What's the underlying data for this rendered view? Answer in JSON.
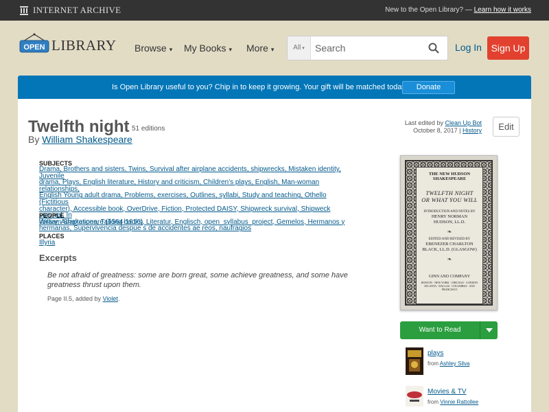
{
  "ia_bar": {
    "logo_text": "INTERNET ARCHIVE",
    "new_text": "New to the Open Library? —",
    "learn_link": "Learn how it works"
  },
  "header": {
    "logo_open": "OPEN",
    "logo_library": "LIBRARY",
    "nav": [
      {
        "label": "Browse"
      },
      {
        "label": "My Books"
      },
      {
        "label": "More"
      }
    ],
    "search": {
      "scope": "All",
      "placeholder": "Search"
    },
    "login": "Log In",
    "signup": "Sign Up"
  },
  "donate": {
    "text": "Is Open Library useful to you? Chip in to keep it growing. Your gift will be matched today!",
    "button": "Donate"
  },
  "work": {
    "title": "Twelfth night",
    "editions": "51 editions",
    "by": "By",
    "author": "William Shakespeare",
    "last_edited_prefix": "Last edited by",
    "last_edited_by": "Clean Up Bot",
    "last_edited_date": "October 8, 2017",
    "history": "History",
    "edit": "Edit"
  },
  "subjects": {
    "heading": "SUBJECTS",
    "lines": [
      "Drama, Brothers and sisters, Twins, Survival after airplane accidents, shipwrecks, Mistaken identity, Juvenile",
      "drama, Plays, English literature, History and criticism, Children's plays, English, Man-woman relationships,",
      "English Young adult drama, Problems, exercises, Outlines, syllabi, Study and teaching, Othello (Fictitious",
      "character), Accessible book, OverDrive, Fiction, Protected DAISY, Shipwreck survival, Shipweck survival, In",
      "library, Adaptations, Talking books, Literatur, Englisch, open_syllabus_project, Gemelos, Hermanos y",
      "hermanas, Supervivencia despue s de accidentes ae reos, naufragios"
    ]
  },
  "people": {
    "heading": "PEOPLE",
    "value": "William Shakespeare (1564-1616)"
  },
  "places": {
    "heading": "PLACES",
    "value": "Illyria"
  },
  "excerpts": {
    "heading": "Excerpts",
    "quote": "Be not afraid of greatness: some are born great, some achieve greatness, and some have greatness thrust upon them.",
    "page_prefix": "Page II.5, added by",
    "added_by": "Violet",
    "page_suffix": "."
  },
  "cover": {
    "series": "THE NEW HUDSON SHAKESPEARE",
    "title1": "TWELFTH NIGHT",
    "title2": "OR WHAT YOU WILL",
    "intro": "INTRODUCTION AND NOTES BY",
    "editor1": "HENRY NORMAN",
    "editor2": "HUDSON, LL.D.",
    "edited_by": "EDITED AND REVISED BY",
    "reviser1": "EBENEZER CHARLTON",
    "reviser2": "BLACK, LL.D. (GLASGOW)",
    "publisher": "GINN AND COMPANY",
    "cities": "BOSTON · NEW YORK · CHICAGO · LONDON ATLANTA · DALLAS · COLUMBUS · SAN FRANCISCO"
  },
  "want_to_read": "Want to Read",
  "lists": [
    {
      "name": "plays",
      "from": "from",
      "user": "Ashley Silva"
    },
    {
      "name": "Movies & TV",
      "from": "from",
      "user": "Vinnie Rattollee"
    }
  ],
  "colors": {
    "signup": "#e2412f",
    "donate_bar": "#0376b8",
    "want_to_read": "#2b9e3f",
    "link": "#02598b"
  }
}
